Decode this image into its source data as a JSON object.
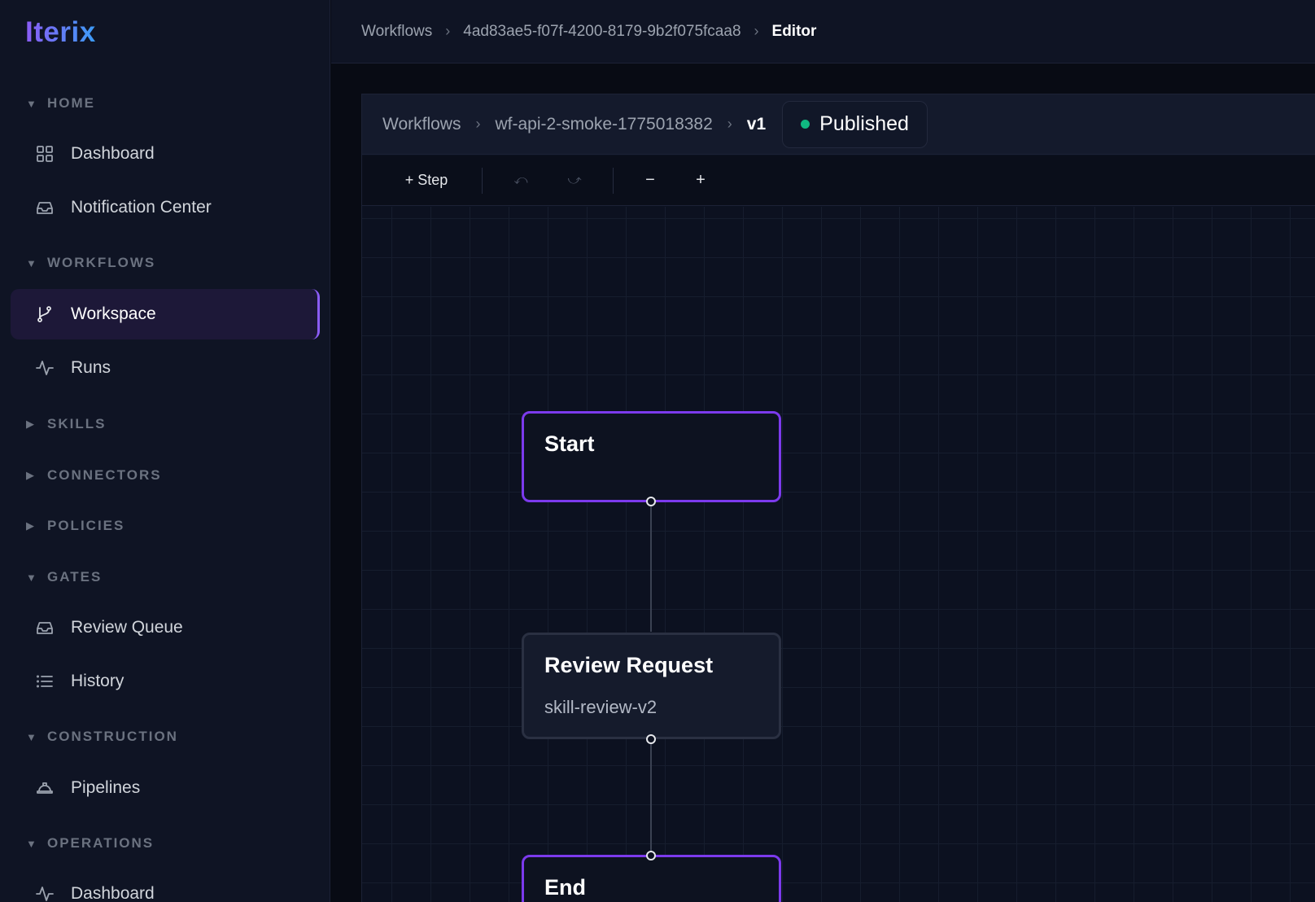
{
  "app": {
    "logo": "Iterix"
  },
  "breadcrumb": {
    "items": [
      "Workflows",
      "4ad83ae5-f07f-4200-8179-9b2f075fcaa8",
      "Editor"
    ]
  },
  "sidebar": {
    "sections": [
      {
        "label": "HOME",
        "expanded": true,
        "items": [
          {
            "label": "Dashboard",
            "icon": "grid-icon"
          },
          {
            "label": "Notification Center",
            "icon": "inbox-icon"
          }
        ]
      },
      {
        "label": "WORKFLOWS",
        "expanded": true,
        "items": [
          {
            "label": "Workspace",
            "icon": "branch-icon",
            "active": true
          },
          {
            "label": "Runs",
            "icon": "activity-icon"
          }
        ]
      },
      {
        "label": "SKILLS",
        "expanded": false,
        "items": []
      },
      {
        "label": "CONNECTORS",
        "expanded": false,
        "items": []
      },
      {
        "label": "POLICIES",
        "expanded": false,
        "items": []
      },
      {
        "label": "GATES",
        "expanded": true,
        "items": [
          {
            "label": "Review Queue",
            "icon": "inbox-icon"
          },
          {
            "label": "History",
            "icon": "list-icon"
          }
        ]
      },
      {
        "label": "CONSTRUCTION",
        "expanded": true,
        "items": [
          {
            "label": "Pipelines",
            "icon": "hard-hat-icon"
          }
        ]
      },
      {
        "label": "OPERATIONS",
        "expanded": true,
        "items": [
          {
            "label": "Dashboard",
            "icon": "activity-icon"
          }
        ]
      }
    ]
  },
  "editor": {
    "breadcrumb": [
      "Workflows",
      "wf-api-2-smoke-1775018382",
      "v1"
    ],
    "status": {
      "label": "Published",
      "color": "#10b981"
    },
    "toolbar": {
      "add_step": "+ Step",
      "undo": "⤺",
      "redo": "⤻",
      "zoom_out": "−",
      "zoom_in": "+"
    }
  },
  "canvas": {
    "nodes": [
      {
        "title": "Start",
        "subtitle": ""
      },
      {
        "title": "Review Request",
        "subtitle": "skill-review-v2"
      },
      {
        "title": "End",
        "subtitle": ""
      }
    ]
  },
  "colors": {
    "accent": "#7c3aed",
    "status_ok": "#10b981"
  }
}
